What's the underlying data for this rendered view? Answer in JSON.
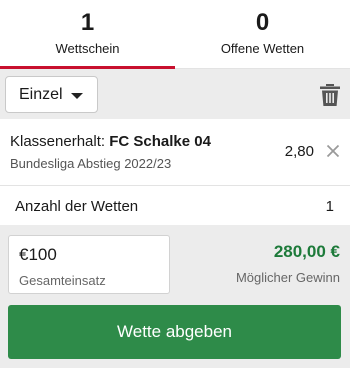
{
  "tabs": [
    {
      "count": "1",
      "label": "Wettschein",
      "active": true
    },
    {
      "count": "0",
      "label": "Offene Wetten",
      "active": false
    }
  ],
  "toolbar": {
    "bet_type": "Einzel",
    "icons": {
      "dropdown": "caret-down-icon",
      "delete": "trash-icon"
    }
  },
  "selection": {
    "market": "Klassenerhalt:",
    "team": "FC Schalke 04",
    "event": "Bundesliga Abstieg 2022/23",
    "odds": "2,80",
    "remove_icon": "close-icon"
  },
  "bets_count": {
    "label": "Anzahl der Wetten",
    "value": "1"
  },
  "stake": {
    "value": "€100",
    "label": "Gesamteinsatz"
  },
  "potential_win": {
    "value": "280,00 €",
    "label": "Möglicher Gewinn"
  },
  "submit": {
    "label": "Wette abgeben"
  },
  "colors": {
    "accent_red": "#c8102e",
    "win_green": "#1d7a3a",
    "button_green": "#2e8b49",
    "panel_grey": "#ececec"
  }
}
